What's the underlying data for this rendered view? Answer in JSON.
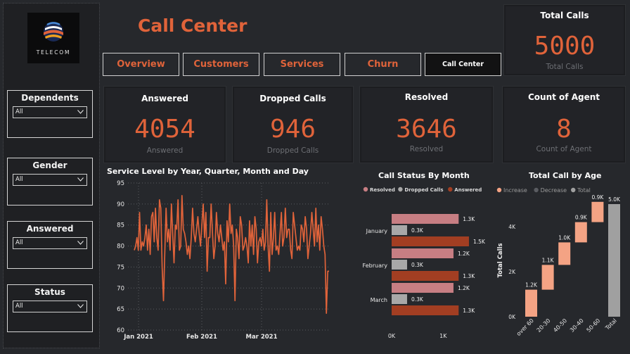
{
  "logo": {
    "text": "TELECOM"
  },
  "title": "Call Center",
  "tabs": [
    {
      "label": "Overview"
    },
    {
      "label": "Customers"
    },
    {
      "label": "Services"
    },
    {
      "label": "Churn"
    },
    {
      "label": "Call Center"
    }
  ],
  "slicers": [
    {
      "title": "Dependents",
      "value": "All"
    },
    {
      "title": "Gender",
      "value": "All"
    },
    {
      "title": "Answered",
      "value": "All"
    },
    {
      "title": "Status",
      "value": "All"
    }
  ],
  "kpis": {
    "total": {
      "title": "Total Calls",
      "value": "5000",
      "sub": "Total Calls"
    },
    "answered": {
      "title": "Answered",
      "value": "4054",
      "sub": "Answered"
    },
    "dropped": {
      "title": "Dropped Calls",
      "value": "946",
      "sub": "Dropped Calls"
    },
    "resolved": {
      "title": "Resolved",
      "value": "3646",
      "sub": "Resolved"
    },
    "agents": {
      "title": "Count of Agent",
      "value": "8",
      "sub": "Count of Agent"
    }
  },
  "colors": {
    "accent": "#e0633a",
    "resolved": "#c77e83",
    "dropped": "#a8a8a8",
    "answered": "#a23e22",
    "increase": "#f4a384",
    "total": "#a0a0a0"
  },
  "chart_data": [
    {
      "type": "line",
      "title": "Service Level by Year, Quarter, Month and Day",
      "x_tick_labels": [
        "Jan 2021",
        "Feb 2021",
        "Mar 2021"
      ],
      "ylim": [
        60,
        95
      ],
      "y_ticks": [
        60,
        65,
        70,
        75,
        80,
        85,
        90,
        95
      ],
      "grid": true,
      "color": "#e0633a",
      "values": [
        79,
        80,
        82,
        79,
        88,
        79,
        81,
        80,
        82,
        85,
        79,
        84,
        78,
        87,
        88,
        81,
        89,
        82,
        79,
        91,
        89,
        75,
        67,
        78,
        89,
        81,
        84,
        79,
        90,
        83,
        76,
        85,
        84,
        91,
        79,
        80,
        92,
        84,
        83,
        81,
        78,
        80,
        77,
        82,
        89,
        83,
        81,
        84,
        87,
        83,
        80,
        85,
        90,
        82,
        88,
        74,
        82,
        82,
        90,
        83,
        77,
        80,
        88,
        83,
        81,
        85,
        82,
        79,
        81,
        71,
        86,
        81,
        90,
        83,
        85,
        80,
        67,
        84,
        82,
        77,
        87,
        85,
        79,
        80,
        82,
        80,
        76,
        86,
        80,
        85,
        78,
        87,
        84,
        76,
        81,
        82,
        80,
        84,
        79,
        81,
        91,
        80,
        74,
        88,
        78,
        82,
        88,
        79,
        80,
        78,
        83,
        88,
        80,
        82,
        89,
        82,
        84,
        84,
        79,
        77,
        88,
        85,
        82,
        79,
        80,
        79,
        85,
        84,
        81,
        87,
        84,
        77,
        80,
        83,
        88,
        84,
        80,
        89,
        81,
        85,
        79,
        87,
        84,
        80,
        78,
        64,
        74,
        74
      ]
    },
    {
      "type": "bar",
      "orientation": "horizontal",
      "title": "Call Status By Month",
      "legend": [
        "Resolved",
        "Dropped Calls",
        "Answered"
      ],
      "legend_position": "top",
      "categories": [
        "January",
        "February",
        "March"
      ],
      "series": [
        {
          "name": "Resolved",
          "values": [
            1300,
            1200,
            1200
          ],
          "labels": [
            "1.3K",
            "1.2K",
            "1.2K"
          ]
        },
        {
          "name": "Dropped Calls",
          "values": [
            300,
            300,
            300
          ],
          "labels": [
            "0.3K",
            "0.3K",
            "0.3K"
          ]
        },
        {
          "name": "Answered",
          "values": [
            1500,
            1300,
            1300
          ],
          "labels": [
            "1.5K",
            "1.3K",
            "1.3K"
          ]
        }
      ],
      "x_tick_labels": [
        "0K",
        "1K"
      ],
      "xlim": [
        0,
        1500
      ]
    },
    {
      "type": "waterfall",
      "title": "Total Call by Age",
      "legend": [
        "Increase",
        "Decrease",
        "Total"
      ],
      "legend_position": "top",
      "ylabel": "Total Calls",
      "y_tick_labels": [
        "0K",
        "2K",
        "4K"
      ],
      "ylim": [
        0,
        5000
      ],
      "categories": [
        "over 60",
        "20-30",
        "40-50",
        "30-40",
        "50-60",
        "Total"
      ],
      "values": [
        1200,
        1100,
        1000,
        900,
        900,
        5000
      ],
      "labels": [
        "1.2K",
        "1.1K",
        "1.0K",
        "0.9K",
        "0.9K",
        "5.0K"
      ]
    }
  ]
}
